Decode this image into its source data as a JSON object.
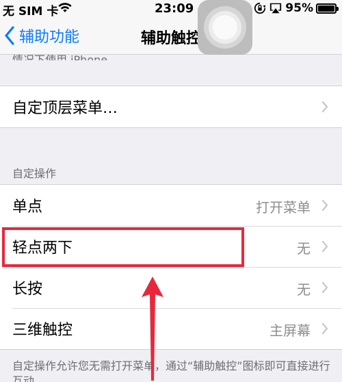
{
  "status_bar": {
    "carrier": "无 SIM 卡",
    "time": "23:09",
    "battery": "95%"
  },
  "nav": {
    "back_label": "辅助功能",
    "title": "辅助触控"
  },
  "top_cut_text": "情况下使用 iPhone。",
  "menu_cell": {
    "label": "自定顶层菜单…"
  },
  "section": {
    "header": "自定操作",
    "rows": [
      {
        "label": "单点",
        "value": "打开菜单"
      },
      {
        "label": "轻点两下",
        "value": "无"
      },
      {
        "label": "长按",
        "value": "无"
      },
      {
        "label": "三维触控",
        "value": "主屏幕"
      }
    ],
    "footer": "自定操作允许您无需打开菜单，通过“辅助触控”图标即可直接进行互动。"
  },
  "annotation": {
    "highlight_color": "#e8283a",
    "target_row": "轻点两下"
  },
  "colors": {
    "accent": "#0a7aff",
    "secondary_text": "#8e8e93",
    "background": "#efeff4"
  },
  "icons": [
    "wifi-icon",
    "rotation-lock-icon",
    "airplay-icon",
    "battery-icon",
    "chevron-left-icon",
    "chevron-right-icon",
    "assistive-touch-icon",
    "arrow-up-icon"
  ]
}
